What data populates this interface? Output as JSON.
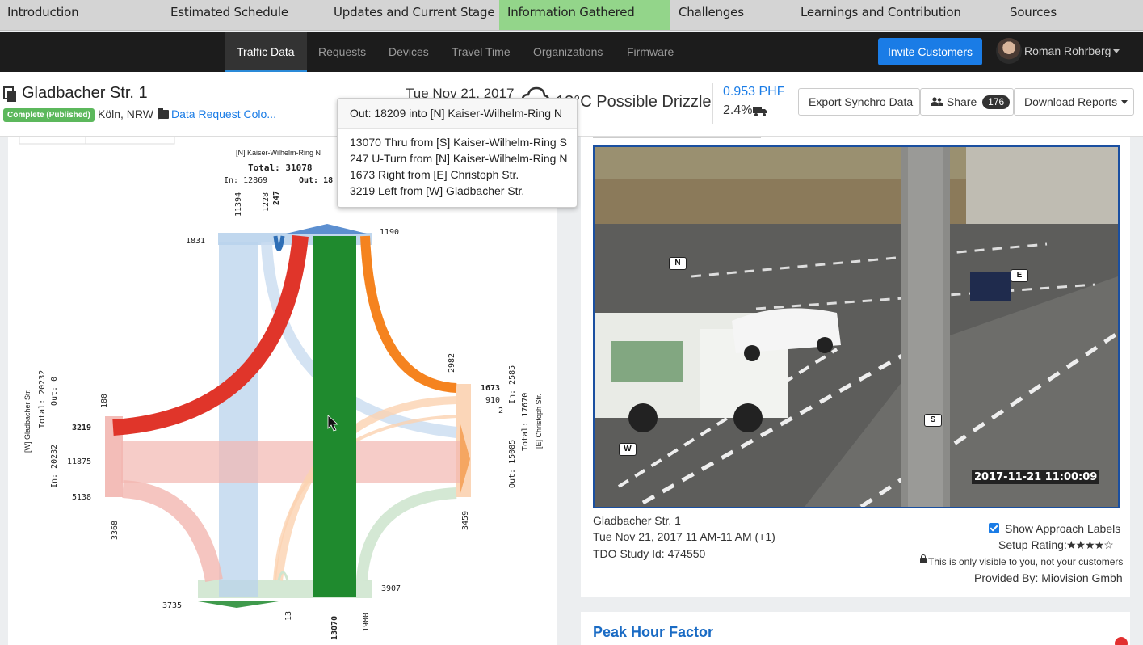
{
  "slide_tabs": [
    {
      "label": "Introduction",
      "active": false
    },
    {
      "label": "Estimated Schedule",
      "active": false
    },
    {
      "label": "Updates and Current Stage",
      "active": false
    },
    {
      "label": "Information Gathered",
      "active": true
    },
    {
      "label": "Challenges",
      "active": false
    },
    {
      "label": "Learnings and Contribution",
      "active": false
    },
    {
      "label": "Sources",
      "active": false
    }
  ],
  "nav": {
    "items": [
      "Traffic Data",
      "Requests",
      "Devices",
      "Travel Time",
      "Organizations",
      "Firmware"
    ],
    "active": "Traffic Data",
    "invite_label": "Invite Customers",
    "user_name": "Roman Rohrberg"
  },
  "header": {
    "title": "Gladbacher Str. 1",
    "status": "Complete (Published)",
    "location": "Köln, NRW |",
    "request_link": "Data Request Colo...",
    "date": "Tue Nov 21, 2017",
    "weather": "13°C Possible Drizzle",
    "phf": "0.953 PHF",
    "heavy_vehicles": "2.4%",
    "export_label": "Export Synchro Data",
    "share_label": "Share",
    "share_count": "176",
    "download_label": "Download Reports"
  },
  "tooltip": {
    "title": "Out: 18209 into [N] Kaiser-Wilhelm-Ring N",
    "lines": [
      "13070 Thru from [S] Kaiser-Wilhelm-Ring S",
      "247 U-Turn from [N] Kaiser-Wilhelm-Ring N",
      "1673 Right from [E] Christoph Str.",
      "3219 Left from [W] Gladbacher Str."
    ]
  },
  "diagram": {
    "north": {
      "name": "[N] Kaiser-Wilhelm-Ring N",
      "total": "Total: 31078",
      "in": "In: 12869",
      "out": "Out: 18",
      "v1": "11394",
      "v2": "1228",
      "v3": "247",
      "left": "1831",
      "right": "1190"
    },
    "west": {
      "name": "[W] Gladbacher Str.",
      "total": "Total: 20232",
      "out": "Out: 0",
      "in": "In: 20232",
      "v1": "180",
      "v2": "3219",
      "v3": "11875",
      "v4": "5138",
      "v5": "3368"
    },
    "east": {
      "name": "[E] Christoph Str.",
      "total": "Total: 17670",
      "in": "In: 2585",
      "out": "Out: 15085",
      "v1": "2982",
      "v2": "1673",
      "v3": "910",
      "v4": "2",
      "v5": "3459"
    },
    "south": {
      "left": "3735",
      "right": "3907",
      "v1": "13",
      "v2": "13070",
      "v3": "1980"
    }
  },
  "camera": {
    "labels": [
      "N",
      "E",
      "S",
      "W"
    ],
    "timestamp": "2017-11-21 11:00:09"
  },
  "study": {
    "name": "Gladbacher Str. 1",
    "time": "Tue Nov 21, 2017 11 AM-11 AM (+1)",
    "tdo": "TDO Study Id: 474550",
    "show_labels": "Show Approach Labels",
    "setup_rating": "Setup Rating:",
    "rating": 4,
    "stars": "★★★★☆",
    "visibility_note": "This is only visible to you, not your customers",
    "provider": "Provided By: Miovision Gmbh"
  },
  "peak_hour_factor_title": "Peak Hour Factor",
  "colors": {
    "left_turn": "#e0352a",
    "thru": "#1f8a2e",
    "right_turn": "#f5831f",
    "west_thru": "#f2b6b0",
    "north_thru": "#b9d3ec",
    "active_tab": "#93d58a",
    "link": "#1a7ce6"
  }
}
